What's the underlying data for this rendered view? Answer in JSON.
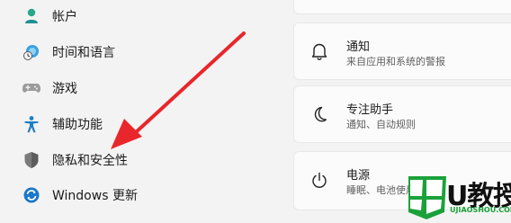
{
  "sidebar": {
    "items": [
      {
        "label": "帐户",
        "icon": "account-icon"
      },
      {
        "label": "时间和语言",
        "icon": "time-language-icon"
      },
      {
        "label": "游戏",
        "icon": "gamepad-icon"
      },
      {
        "label": "辅助功能",
        "icon": "accessibility-icon"
      },
      {
        "label": "隐私和安全性",
        "icon": "shield-icon"
      },
      {
        "label": "Windows 更新",
        "icon": "windows-update-icon"
      }
    ]
  },
  "cards": [
    {
      "title": "通知",
      "desc": "来自应用和系统的警报",
      "icon": "bell-icon"
    },
    {
      "title": "专注助手",
      "desc": "通知、自动规则",
      "icon": "moon-icon"
    },
    {
      "title": "电源",
      "desc": "睡眠、电池使用情况",
      "icon": "power-icon"
    }
  ],
  "watermark": {
    "brand": "U教授",
    "url": "UJIAOSHOU.COM"
  },
  "colors": {
    "accent": "#0067c0",
    "arrow": "#e8262b",
    "watermark_green": "#1aa13a"
  }
}
